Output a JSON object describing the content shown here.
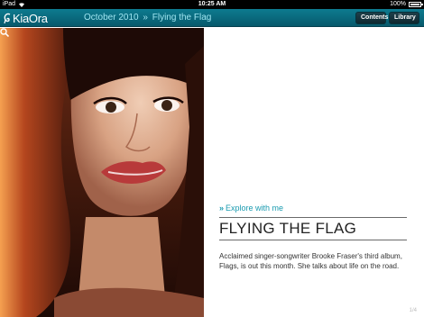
{
  "status_bar": {
    "device": "iPad",
    "time": "10:25 AM",
    "battery": "100%"
  },
  "nav": {
    "logo_text": "KiaOra",
    "issue": "October 2010",
    "separator": "»",
    "article": "Flying the Flag",
    "contents_label": "Contents",
    "library_label": "Library"
  },
  "article": {
    "kicker_chevron": "»",
    "kicker": "Explore with me",
    "headline": "FLYING THE FLAG",
    "body": "Acclaimed singer-songwriter Brooke Fraser's third album, Flags, is out this month. She talks about life on the road.",
    "page_indicator": "1/4"
  },
  "colors": {
    "nav_teal": "#0d7b90",
    "accent": "#1a9bb0"
  },
  "icons": {
    "zoom": "magnifier-icon",
    "wifi": "wifi-icon",
    "battery": "battery-icon"
  }
}
